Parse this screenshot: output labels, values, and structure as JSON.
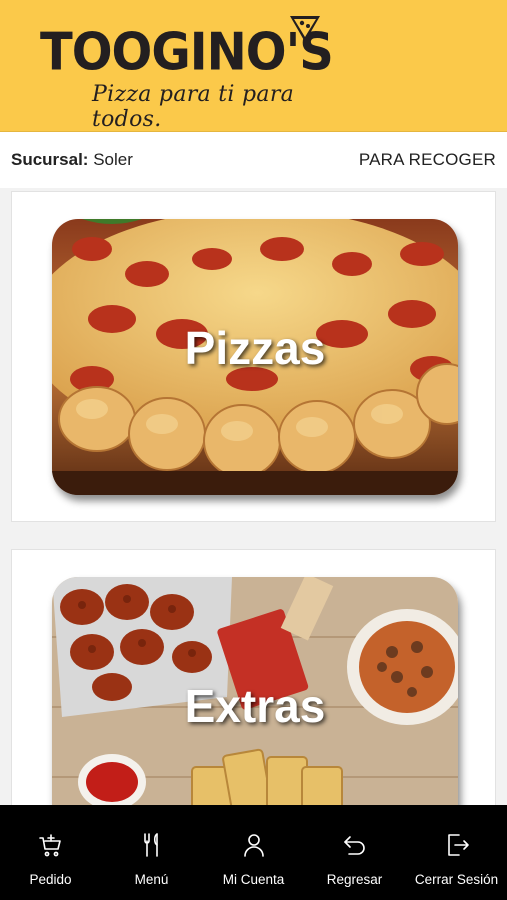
{
  "header": {
    "logo_text": "TOOGINO'S",
    "tagline": "Pizza para ti para todos."
  },
  "info_bar": {
    "branch_label": "Sucursal:",
    "branch_value": "Soler",
    "mode": "PARA RECOGER"
  },
  "categories": [
    {
      "title": "Pizzas"
    },
    {
      "title": "Extras"
    }
  ],
  "bottom_nav": {
    "items": [
      {
        "label": "Pedido",
        "icon": "cart-icon"
      },
      {
        "label": "Menú",
        "icon": "fork-knife-icon"
      },
      {
        "label": "Mi Cuenta",
        "icon": "user-icon"
      },
      {
        "label": "Regresar",
        "icon": "back-arrow-icon"
      },
      {
        "label": "Cerrar Sesión",
        "icon": "logout-icon"
      }
    ]
  },
  "colors": {
    "header_bg": "#fbc94a",
    "nav_bg": "#000000",
    "text_dark": "#231f20"
  }
}
